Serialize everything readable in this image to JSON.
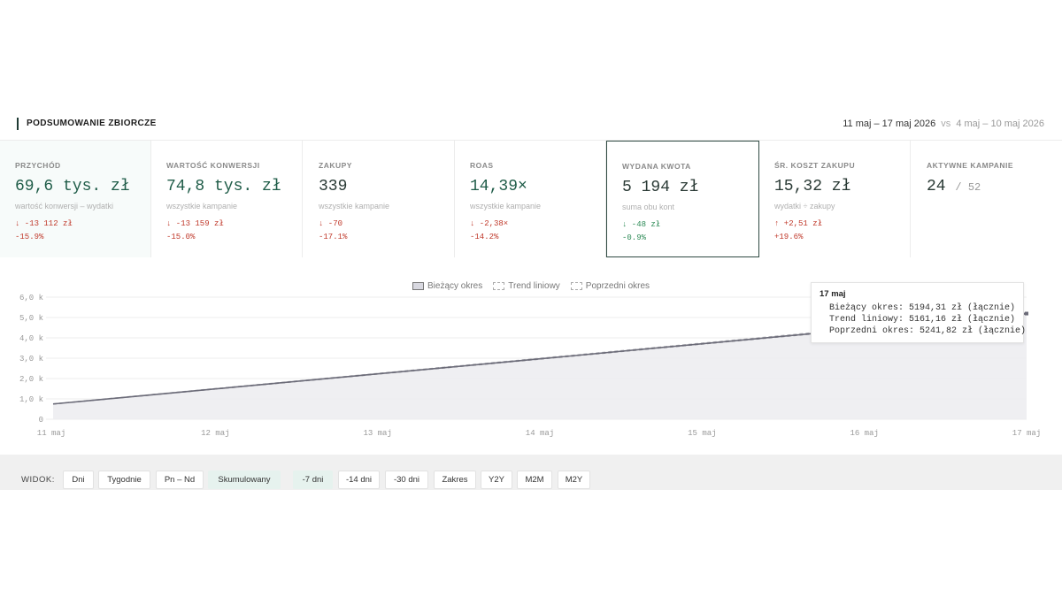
{
  "header": {
    "title": "PODSUMOWANIE ZBIORCZE",
    "current_range": "11 maj – 17 maj 2026",
    "vs": "vs",
    "previous_range": "4 maj – 10 maj 2026"
  },
  "cards": [
    {
      "label": "PRZYCHÓD",
      "value": "69,6 tys. zł",
      "sub": "wartość konwersji – wydatki",
      "delta_abs": "↓ -13 112 zł",
      "delta_pct": "-15.9%",
      "trend": "down-bad"
    },
    {
      "label": "WARTOŚĆ KONWERSJI",
      "value": "74,8 tys. zł",
      "sub": "wszystkie kampanie",
      "delta_abs": "↓ -13 159 zł",
      "delta_pct": "-15.0%",
      "trend": "down-bad"
    },
    {
      "label": "ZAKUPY",
      "value": "339",
      "sub": "wszystkie kampanie",
      "delta_abs": "↓ -70",
      "delta_pct": "-17.1%",
      "trend": "down-bad"
    },
    {
      "label": "ROAS",
      "value": "14,39×",
      "sub": "wszystkie kampanie",
      "delta_abs": "↓ -2,38×",
      "delta_pct": "-14.2%",
      "trend": "down-bad"
    },
    {
      "label": "WYDANA KWOTA",
      "value": "5 194 zł",
      "sub": "suma obu kont",
      "delta_abs": "↓ -48 zł",
      "delta_pct": "-0.9%",
      "trend": "down-good"
    },
    {
      "label": "ŚR. KOSZT ZAKUPU",
      "value": "15,32 zł",
      "sub": "wydatki ÷ zakupy",
      "delta_abs": "↑ +2,51 zł",
      "delta_pct": "+19.6%",
      "trend": "up-bad"
    },
    {
      "label": "AKTYWNE KAMPANIE",
      "value": "24",
      "value_den": "/ 52"
    }
  ],
  "legend": {
    "current": "Bieżący okres",
    "trend": "Trend liniowy",
    "previous": "Poprzedni okres"
  },
  "tooltip": {
    "title": "17 maj",
    "row1": "Bieżący okres: 5194,31 zł (łącznie)",
    "row2": "Trend liniowy: 5161,16 zł (łącznie)",
    "row3": "Poprzedni okres: 5241,82 zł (łącznie)"
  },
  "toolbar": {
    "label": "WIDOK:",
    "view_buttons": [
      "Dni",
      "Tygodnie",
      "Pn – Nd",
      "Skumulowany"
    ],
    "view_active": "Skumulowany",
    "range_buttons": [
      "-7 dni",
      "-14 dni",
      "-30 dni",
      "Zakres",
      "Y2Y",
      "M2M",
      "M2Y"
    ],
    "range_active": "-7 dni"
  },
  "colors": {
    "accent": "#1f3b34",
    "positive_value": "#1f5c48",
    "negative_delta": "#c0392b",
    "positive_delta": "#2e8b57",
    "active_button": "#e6f2ee"
  },
  "chart_data": {
    "type": "area",
    "x": [
      "11 maj",
      "12 maj",
      "13 maj",
      "14 maj",
      "15 maj",
      "16 maj",
      "17 maj"
    ],
    "yticks": [
      "0",
      "1,0 k",
      "2,0 k",
      "3,0 k",
      "4,0 k",
      "5,0 k",
      "6,0 k"
    ],
    "ylim": [
      0,
      6000
    ],
    "grid": true,
    "legend_position": "top-center",
    "series": [
      {
        "name": "Bieżący okres",
        "values": [
          750,
          1490,
          2230,
          2970,
          3710,
          4450,
          5194.31
        ]
      },
      {
        "name": "Trend liniowy",
        "values": [
          745,
          1480,
          2215,
          2950,
          3690,
          4425,
          5161.16
        ]
      },
      {
        "name": "Poprzedni okres",
        "values": [
          760,
          1510,
          2255,
          3000,
          3745,
          4495,
          5241.82
        ]
      }
    ]
  }
}
